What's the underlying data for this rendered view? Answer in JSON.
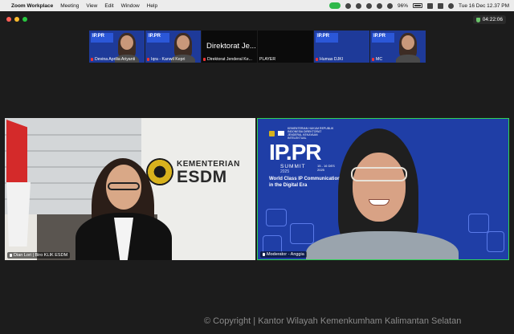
{
  "menubar": {
    "app_name": "Zoom Workplace",
    "menus": [
      "Meeting",
      "View",
      "Edit",
      "Window",
      "Help"
    ],
    "battery": "96%",
    "clock": "Tue 16 Dec  12.37 PM"
  },
  "meeting": {
    "elapsed": "04:22:06"
  },
  "gallery_strip": [
    {
      "name": "Devina Aprilia Ariyanti",
      "muted": true
    },
    {
      "name": "Iqra - Kanwil Kepri",
      "muted": true
    },
    {
      "display": "Direktorat Je...",
      "name": "Direktorat Jenderal Ke...",
      "muted": true
    },
    {
      "name": "PLAYER",
      "muted": false
    },
    {
      "name": "Humas DJKI",
      "muted": true
    },
    {
      "name": "MC",
      "muted": true
    }
  ],
  "main_videos": {
    "left": {
      "label": "Dian Lori | Biro KLIK ESDM",
      "logo_line1": "KEMENTERIAN",
      "logo_line2": "ESDM"
    },
    "right": {
      "label": "Moderator - Anggia",
      "badge_text": "KEMENTERIAN HUKUM REPUBLIK INDONESIA DIREKTORAT JENDERAL KEKAYAAN INTELEKTUAL",
      "event_title": "IP.PR",
      "event_subtitle": "SUMMIT",
      "event_year": "2025",
      "event_dates": "15 - 16 DES 2025",
      "tagline_line1": "World Class IP Communication",
      "tagline_line2": "in the Digital Era"
    }
  },
  "footer": {
    "copyright": "© Copyright | Kantor Wilayah Kemenkumham Kalimantan Selatan"
  },
  "colors": {
    "active_speaker_border": "#30d158",
    "summit_blue": "#1f3ea6",
    "zoom_green": "#2fb84a"
  }
}
